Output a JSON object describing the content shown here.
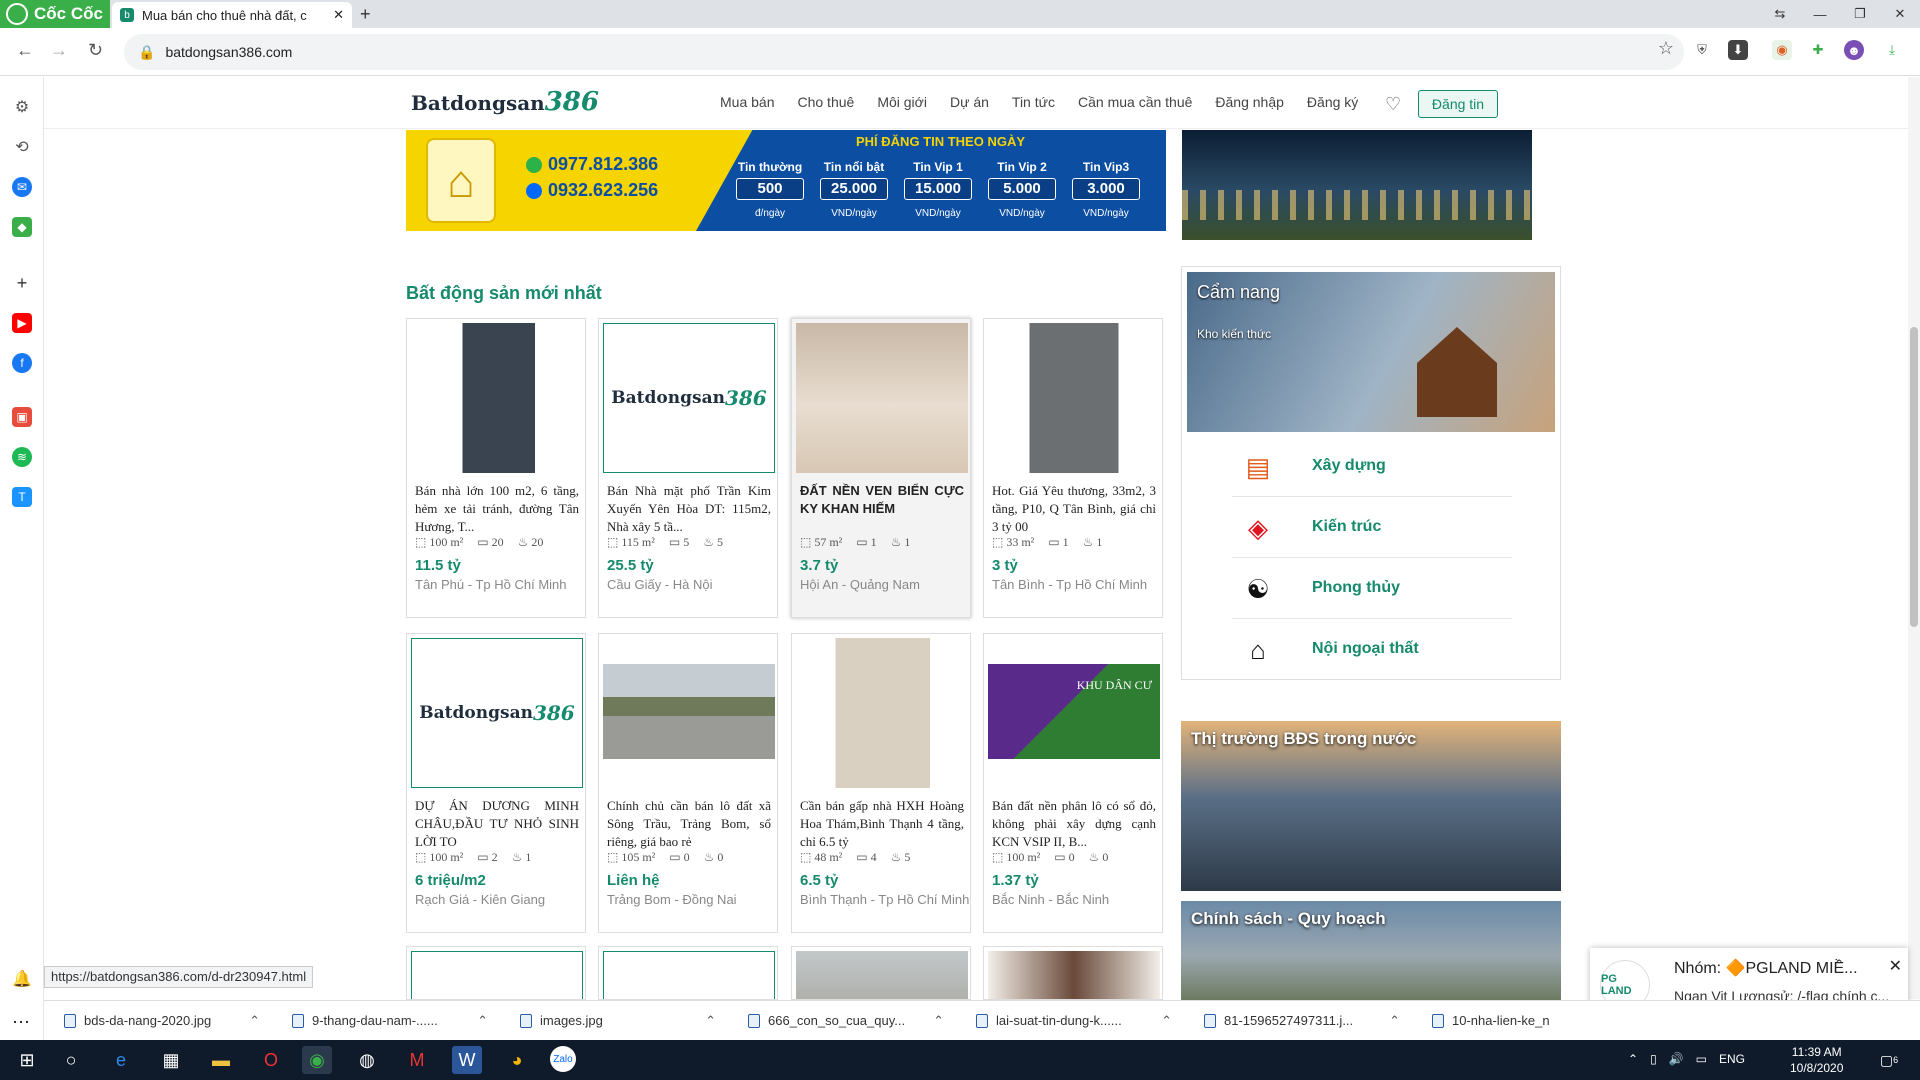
{
  "browser": {
    "brand": "Cốc Cốc",
    "tab_title": "Mua bán cho thuê nhà đất, c",
    "url": "batdongsan386.com",
    "status_url": "https://batdongsan386.com/d-dr230947.html"
  },
  "site": {
    "logo_text": "Batdongsan",
    "logo_num": "386",
    "menu": [
      "Mua bán",
      "Cho thuê",
      "Môi giới",
      "Dự án",
      "Tin tức",
      "Cần mua cần thuê",
      "Đăng nhập",
      "Đăng ký"
    ],
    "post_button": "Đăng tin"
  },
  "banner": {
    "phone1": "0977.812.386",
    "phone2": "0932.623.256",
    "fee_title": "PHÍ ĐĂNG TIN THEO NGÀY",
    "fees": [
      {
        "name": "Tin thường",
        "value": "500",
        "unit": "đ/ngày"
      },
      {
        "name": "Tin nổi bật",
        "value": "25.000",
        "unit": "VND/ngày"
      },
      {
        "name": "Tin Vip 1",
        "value": "15.000",
        "unit": "VND/ngày"
      },
      {
        "name": "Tin Vip 2",
        "value": "5.000",
        "unit": "VND/ngày"
      },
      {
        "name": "Tin Vip3",
        "value": "3.000",
        "unit": "VND/ngày"
      }
    ]
  },
  "section_title": "Bất động sản mới nhất",
  "listings": [
    {
      "desc": "Bán nhà lớn 100 m2, 6 tầng, hẻm xe tải tránh, đường Tân Hương, T...",
      "area": "100 m²",
      "beds": "20",
      "baths": "20",
      "price": "11.5 tỷ",
      "loc": "Tân Phú - Tp Hồ Chí Minh"
    },
    {
      "desc": "Bán Nhà mặt phố Trần Kim Xuyến Yên Hòa DT: 115m2, Nhà xây 5 tầ...",
      "area": "115 m²",
      "beds": "5",
      "baths": "5",
      "price": "25.5 tỷ",
      "loc": "Cầu Giấy - Hà Nội"
    },
    {
      "desc": "ĐẤT NỀN VEN BIỂN CỰC KY KHAN HIẾM",
      "area": "57 m²",
      "beds": "1",
      "baths": "1",
      "price": "3.7 tỷ",
      "loc": "Hội An - Quảng Nam"
    },
    {
      "desc": "Hot. Giá Yêu thương, 33m2, 3 tầng, P10, Q Tân Bình, giá chỉ 3 tỷ 00",
      "area": "33 m²",
      "beds": "1",
      "baths": "1",
      "price": "3 tỷ",
      "loc": "Tân Bình - Tp Hồ Chí Minh"
    },
    {
      "desc": "DỰ ÁN DƯƠNG MINH CHÂU,ĐẦU TƯ NHỎ SINH LỜI TO",
      "area": "100 m²",
      "beds": "2",
      "baths": "1",
      "price": "6 triệu/m2",
      "loc": "Rạch Giá - Kiên Giang"
    },
    {
      "desc": "Chính chủ cần bán lô đất xã Sông Trầu, Trảng Bom, sổ riêng, giá bao rẻ",
      "area": "105 m²",
      "beds": "0",
      "baths": "0",
      "price": "Liên hệ",
      "loc": "Trảng Bom - Đồng Nai"
    },
    {
      "desc": "Cần bán gấp nhà HXH Hoàng Hoa Thám,Bình Thạnh 4 tầng, chỉ 6.5 tỷ",
      "area": "48 m²",
      "beds": "4",
      "baths": "5",
      "price": "6.5 tỷ",
      "loc": "Bình Thạnh - Tp Hồ Chí Minh"
    },
    {
      "desc": "Bán đất nền phân lô có sổ đỏ, không phải xây dựng cạnh KCN VSIP II, B...",
      "area": "100 m²",
      "beds": "0",
      "baths": "0",
      "price": "1.37 tỷ",
      "loc": "Bắc Ninh - Bắc Ninh"
    }
  ],
  "khu_dan_cu": "KHU DÂN CƯ",
  "camnang": {
    "title": "Cẩm nang",
    "subtitle": "Kho kiến thức",
    "items": [
      "Xây dựng",
      "Kiến trúc",
      "Phong thủy",
      "Nội ngoại thất"
    ]
  },
  "news": [
    "Thị trường BĐS trong nước",
    "Chính sách - Quy hoạch"
  ],
  "notification": {
    "group": "Nhóm: 🔶PGLAND MIỀ...",
    "message": "Ngan Vit Lượngsử: /-flag chính c...",
    "avatar": "PG LAND"
  },
  "downloads": [
    "bds-da-nang-2020.jpg",
    "9-thang-dau-nam-......",
    "images.jpg",
    "666_con_so_cua_quy...",
    "lai-suat-tin-dung-k......",
    "81-1596527497311.j...",
    "10-nha-lien-ke_n"
  ],
  "taskbar": {
    "lang": "ENG",
    "time": "11:39 AM",
    "date": "10/8/2020",
    "badge": "6"
  }
}
